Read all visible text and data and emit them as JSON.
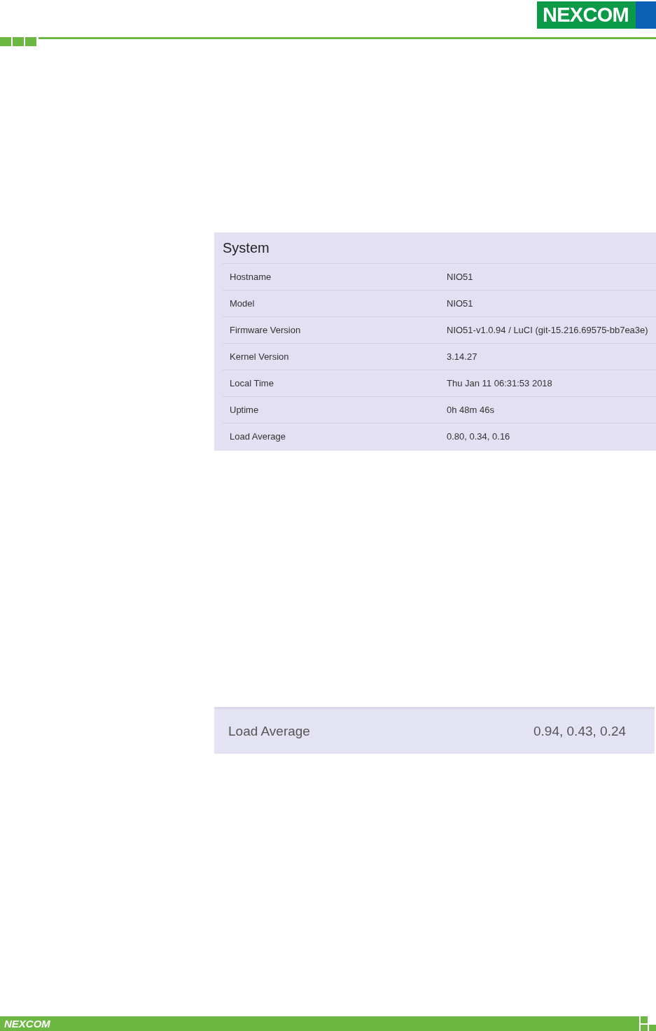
{
  "header": {
    "logo": "NEXCOM"
  },
  "system_panel": {
    "title": "System",
    "rows": [
      {
        "label": "Hostname",
        "value": "NIO51"
      },
      {
        "label": "Model",
        "value": "NIO51"
      },
      {
        "label": "Firmware Version",
        "value": "NIO51-v1.0.94 / LuCI (git-15.216.69575-bb7ea3e)"
      },
      {
        "label": "Kernel Version",
        "value": "3.14.27"
      },
      {
        "label": "Local Time",
        "value": "Thu Jan 11 06:31:53 2018"
      },
      {
        "label": "Uptime",
        "value": "0h 48m 46s"
      },
      {
        "label": "Load Average",
        "value": "0.80, 0.34, 0.16"
      }
    ]
  },
  "load_panel": {
    "label": "Load Average",
    "value": "0.94, 0.43, 0.24"
  },
  "footer": {
    "logo": "NEXCOM"
  }
}
